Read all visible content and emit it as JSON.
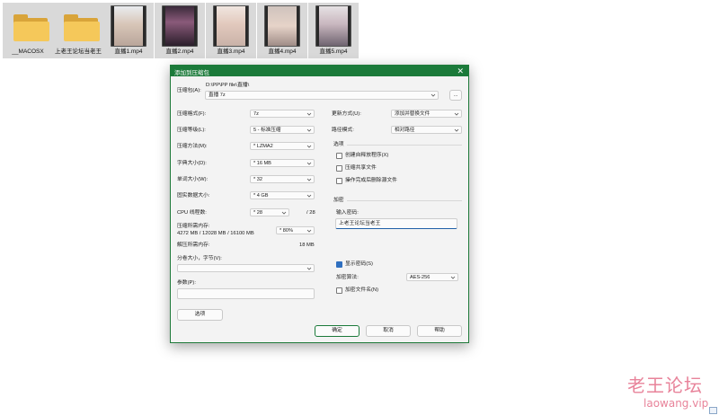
{
  "desktop": {
    "files": [
      {
        "name": "__MACOSX",
        "type": "folder"
      },
      {
        "name": "上老王论坛当老王",
        "type": "folder"
      },
      {
        "name": "直播1.mp4",
        "type": "video"
      },
      {
        "name": "直播2.mp4",
        "type": "video"
      },
      {
        "name": "直播3.mp4",
        "type": "video"
      },
      {
        "name": "直播4.mp4",
        "type": "video"
      },
      {
        "name": "直播5.mp4",
        "type": "video"
      }
    ]
  },
  "dialog": {
    "title": "添加到压缩包",
    "close_glyph": "✕",
    "archive": {
      "label": "压缩包(A):",
      "path": "D:\\PP\\PP file\\直播\\",
      "filename": "直播 7z",
      "browse_label": "..."
    },
    "left": {
      "format_label": "压缩格式(F):",
      "format_value": "7z",
      "level_label": "压缩等级(L):",
      "level_value": "5 - 标准压缩",
      "method_label": "压缩方法(M):",
      "method_value": "* LZMA2",
      "dict_label": "字典大小(D):",
      "dict_value": "* 16 MB",
      "word_label": "单词大小(W):",
      "word_value": "* 32",
      "solid_label": "固实数据大小:",
      "solid_value": "* 4 GB",
      "cpu_label": "CPU 线程数:",
      "cpu_value": "* 28",
      "cpu_total": "/ 28",
      "mem_label": "压缩所需内存:",
      "mem_detail": "4272 MB / 12028 MB / 16100 MB",
      "mem_pct": "* 80%",
      "decomp_label": "解压所需内存:",
      "decomp_value": "18 MB",
      "split_label": "分卷大小，字节(V):",
      "params_label": "参数(P):",
      "options_button": "选项"
    },
    "right": {
      "update_label": "更新方式(U):",
      "update_value": "添加并替换文件",
      "pathmode_label": "路径模式:",
      "pathmode_value": "相对路径",
      "options_header": "选项",
      "opt_sfx": "创建自释放程序(X)",
      "opt_shared": "压缩共享文件",
      "opt_delete": "操作完成后删除源文件",
      "encrypt_header": "加密",
      "password_label": "输入密码:",
      "password_value": "上老王论坛当老王",
      "show_password": "显示密码(S)",
      "method_label": "加密算法:",
      "method_value": "AES-256",
      "encrypt_names": "加密文件名(N)"
    },
    "buttons": {
      "ok": "确定",
      "cancel": "取消",
      "help": "帮助"
    }
  },
  "watermark": {
    "text_cn": "老王论坛",
    "text_en": "laowang.vip"
  },
  "colors": {
    "titlebar": "#1b7a3a",
    "folder": "#f5c85a",
    "watermark": "#e8839a",
    "check": "#2f6fbf"
  }
}
